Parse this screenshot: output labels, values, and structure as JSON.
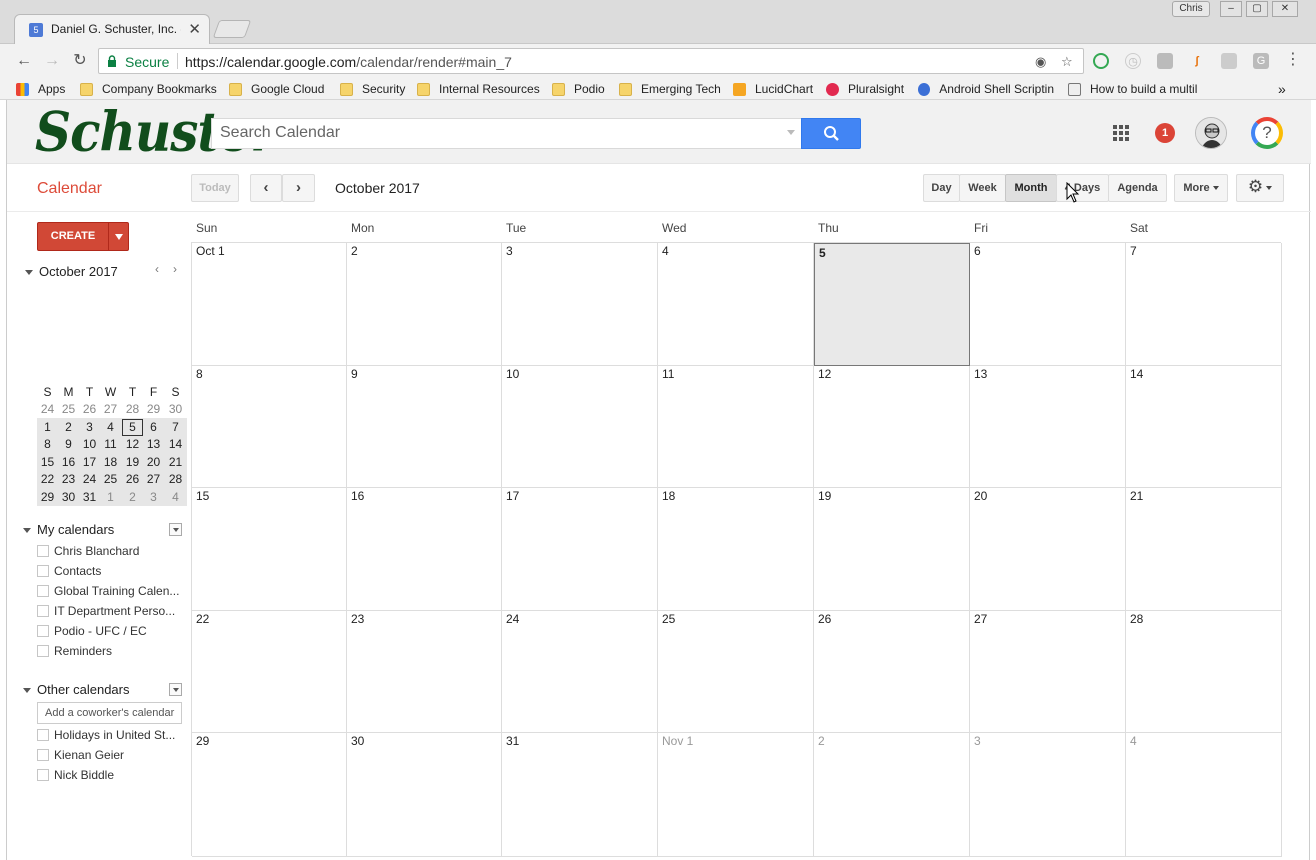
{
  "browser": {
    "tab_title": "Daniel G. Schuster, Inc. -",
    "tab_favicon": "5",
    "user_chip": "Chris",
    "secure_label": "Secure",
    "url_host": "https://calendar.google.com",
    "url_path": "/calendar/render#main_7",
    "bookmarks": [
      {
        "label": "Apps",
        "icon": "apps-grid-icon"
      },
      {
        "label": "Company Bookmarks",
        "icon": "folder-icon"
      },
      {
        "label": "Google Cloud",
        "icon": "folder-icon"
      },
      {
        "label": "Security",
        "icon": "folder-icon"
      },
      {
        "label": "Internal Resources",
        "icon": "folder-icon"
      },
      {
        "label": "Podio",
        "icon": "folder-icon"
      },
      {
        "label": "Emerging Tech",
        "icon": "folder-icon"
      },
      {
        "label": "LucidChart",
        "icon": "lucidchart-icon"
      },
      {
        "label": "Pluralsight",
        "icon": "pluralsight-icon"
      },
      {
        "label": "Android Shell Scriptin",
        "icon": "gear-icon"
      },
      {
        "label": "How to build a multil",
        "icon": "link-icon"
      }
    ],
    "overflow": "»"
  },
  "header": {
    "logo_text": "Schuster",
    "search_placeholder": "Search Calendar",
    "notification_count": "1",
    "help_label": "?"
  },
  "toolbar": {
    "calendar_title": "Calendar",
    "today": "Today",
    "period": "October 2017",
    "views": [
      "Day",
      "Week",
      "Month",
      "4 Days",
      "Agenda"
    ],
    "active_view": "Month",
    "more": "More"
  },
  "sidebar": {
    "create": "CREATE",
    "mini_title": "October 2017",
    "mini_prev": "‹",
    "mini_next": "›",
    "mini_headers": [
      "S",
      "M",
      "T",
      "W",
      "T",
      "F",
      "S"
    ],
    "mini_weeks": [
      [
        "24",
        "25",
        "26",
        "27",
        "28",
        "29",
        "30"
      ],
      [
        "1",
        "2",
        "3",
        "4",
        "5",
        "6",
        "7"
      ],
      [
        "8",
        "9",
        "10",
        "11",
        "12",
        "13",
        "14"
      ],
      [
        "15",
        "16",
        "17",
        "18",
        "19",
        "20",
        "21"
      ],
      [
        "22",
        "23",
        "24",
        "25",
        "26",
        "27",
        "28"
      ],
      [
        "29",
        "30",
        "31",
        "1",
        "2",
        "3",
        "4"
      ]
    ],
    "my_calendars_title": "My calendars",
    "my_calendars": [
      "Chris Blanchard",
      "Contacts",
      "Global Training Calen...",
      "IT Department Perso...",
      "Podio - UFC / EC",
      "Reminders"
    ],
    "other_calendars_title": "Other calendars",
    "coworker_placeholder": "Add a coworker's calendar",
    "other_calendars": [
      "Holidays in United St...",
      "Kienan Geier",
      "Nick Biddle"
    ]
  },
  "month": {
    "weekdays": [
      "Sun",
      "Mon",
      "Tue",
      "Wed",
      "Thu",
      "Fri",
      "Sat"
    ],
    "weeks": [
      [
        "Oct 1",
        "2",
        "3",
        "4",
        "5",
        "6",
        "7"
      ],
      [
        "8",
        "9",
        "10",
        "11",
        "12",
        "13",
        "14"
      ],
      [
        "15",
        "16",
        "17",
        "18",
        "19",
        "20",
        "21"
      ],
      [
        "22",
        "23",
        "24",
        "25",
        "26",
        "27",
        "28"
      ],
      [
        "29",
        "30",
        "31",
        "Nov 1",
        "2",
        "3",
        "4"
      ]
    ],
    "today_label": "5"
  },
  "colors": {
    "accent_red": "#dd4b39",
    "create_red": "#d14836",
    "search_blue": "#4285f4",
    "secure_green": "#0b8043"
  }
}
